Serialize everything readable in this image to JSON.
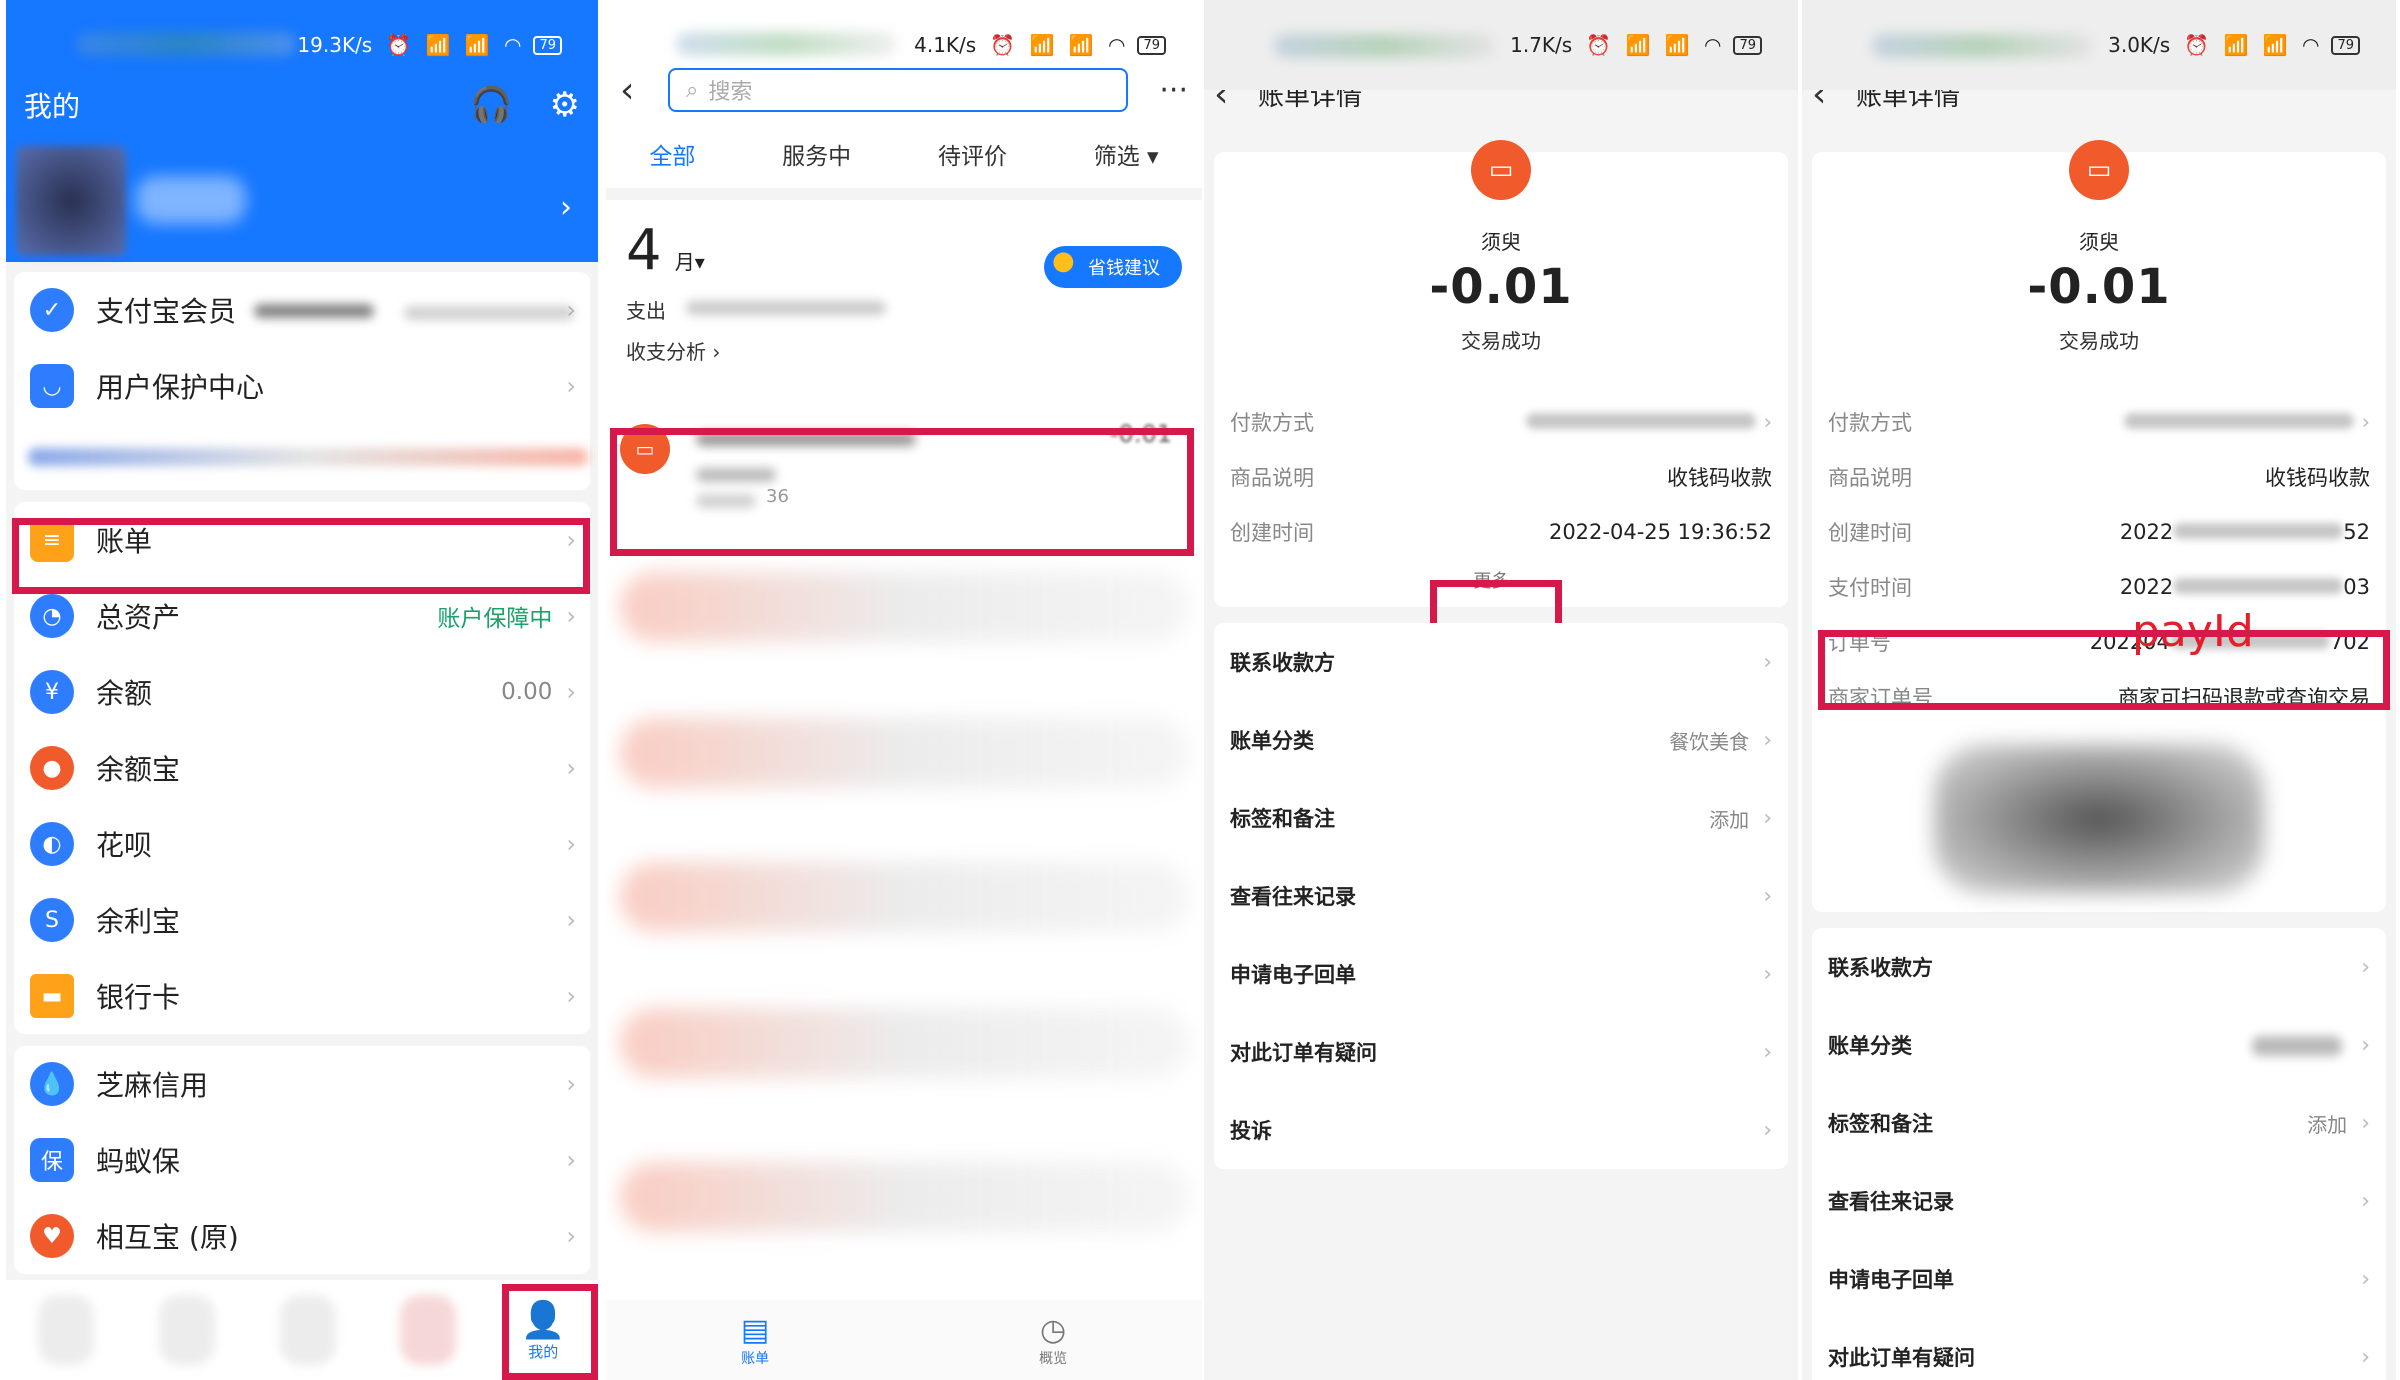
{
  "status_bars": [
    {
      "speed": "19.3K/s",
      "battery": "79"
    },
    {
      "speed": "4.1K/s",
      "battery": "79"
    },
    {
      "speed": "1.7K/s",
      "battery": "79"
    },
    {
      "speed": "3.0K/s",
      "battery": "79"
    }
  ],
  "mine": {
    "title": "我的",
    "menu1": [
      {
        "label": "支付宝会员",
        "value": ""
      },
      {
        "label": "用户保护中心",
        "value": ""
      }
    ],
    "menu2": [
      {
        "label": "账单",
        "value": ""
      },
      {
        "label": "总资产",
        "value": "账户保障中"
      },
      {
        "label": "余额",
        "value": "0.00"
      },
      {
        "label": "余额宝",
        "value": ""
      },
      {
        "label": "花呗",
        "value": ""
      },
      {
        "label": "余利宝",
        "value": ""
      },
      {
        "label": "银行卡",
        "value": ""
      }
    ],
    "menu3": [
      {
        "label": "芝麻信用",
        "value": ""
      },
      {
        "label": "蚂蚁保",
        "value": ""
      },
      {
        "label": "相互宝 (原)",
        "value": ""
      }
    ],
    "tab_mine": "我的"
  },
  "bill_list": {
    "search_placeholder": "搜索",
    "tabs": [
      "全部",
      "服务中",
      "待评价",
      "筛选 ▾"
    ],
    "month_num": "4",
    "month_unit": "月▾",
    "expense_label": "支出",
    "analysis_link": "收支分析 ›",
    "save_tip": "省钱建议",
    "first_txn_amount": "-0.01",
    "first_txn_suffix": "36",
    "tab_bill": "账单",
    "tab_overview": "概览"
  },
  "detail1": {
    "title": "账单详情",
    "merchant": "须臾",
    "amount": "-0.01",
    "status": "交易成功",
    "rows": [
      {
        "k": "付款方式",
        "v": ""
      },
      {
        "k": "商品说明",
        "v": "收钱码收款"
      },
      {
        "k": "创建时间",
        "v": "2022-04-25 19:36:52"
      }
    ],
    "more": "更多 ⌵",
    "links": [
      {
        "label": "联系收款方",
        "value": ""
      },
      {
        "label": "账单分类",
        "value": "餐饮美食"
      },
      {
        "label": "标签和备注",
        "value": "添加"
      },
      {
        "label": "查看往来记录",
        "value": ""
      },
      {
        "label": "申请电子回单",
        "value": ""
      },
      {
        "label": "对此订单有疑问",
        "value": ""
      },
      {
        "label": "投诉",
        "value": ""
      }
    ]
  },
  "detail2": {
    "title": "账单详情",
    "merchant": "须臾",
    "amount": "-0.01",
    "status": "交易成功",
    "rows": [
      {
        "k": "付款方式",
        "v": ""
      },
      {
        "k": "商品说明",
        "v": "收钱码收款"
      },
      {
        "k": "创建时间",
        "v": "2022"
      },
      {
        "k": "支付时间",
        "v": "2022"
      },
      {
        "k": "订单号",
        "v": "202204"
      },
      {
        "k": "商家订单号",
        "v": "商家可扫码退款或查询交易"
      }
    ],
    "create_suffix": "52",
    "pay_suffix": "03",
    "order_suffix": "702",
    "payid_annotation": "payId",
    "links": [
      {
        "label": "联系收款方",
        "value": ""
      },
      {
        "label": "账单分类",
        "value": ""
      },
      {
        "label": "标签和备注",
        "value": "添加"
      },
      {
        "label": "查看往来记录",
        "value": ""
      },
      {
        "label": "申请电子回单",
        "value": ""
      },
      {
        "label": "对此订单有疑问",
        "value": ""
      }
    ]
  },
  "colors": {
    "brand_blue": "#1677ff",
    "highlight_red": "#d6184b",
    "merchant_orange": "#f15a2a",
    "annotation_red": "#e41e2b"
  }
}
